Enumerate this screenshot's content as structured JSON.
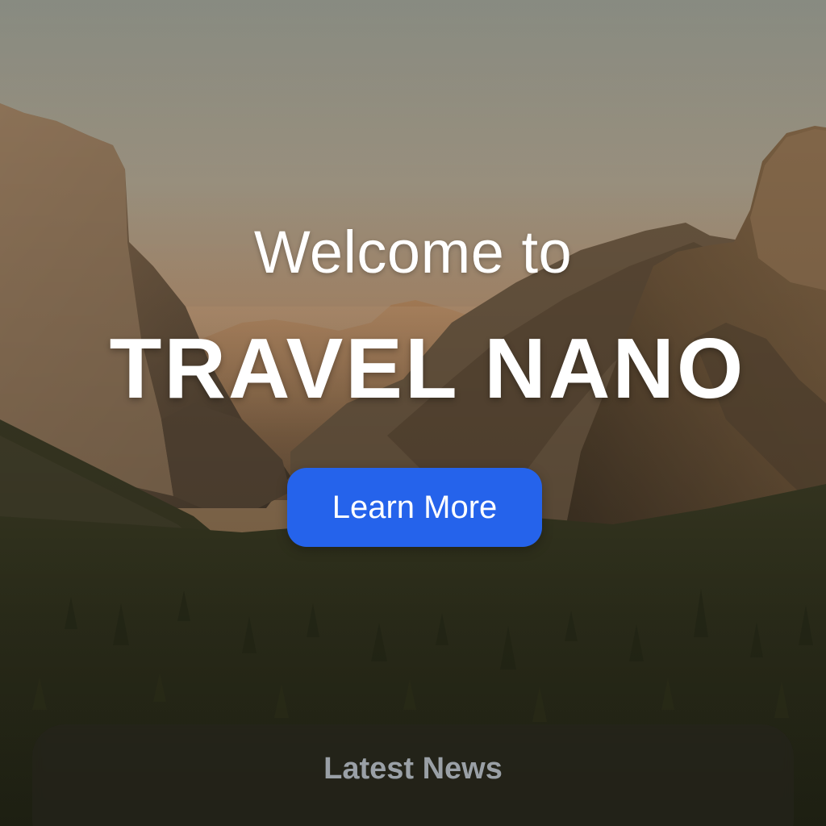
{
  "hero": {
    "welcome_text": "Welcome to",
    "brand_name": "TRAVEL NANO",
    "cta_label": "Learn More",
    "background_image": "mountain-valley-sunset"
  },
  "news": {
    "title": "Latest News"
  },
  "colors": {
    "button": "#2563eb",
    "text": "#ffffff",
    "news_title": "#9aa0a6"
  }
}
